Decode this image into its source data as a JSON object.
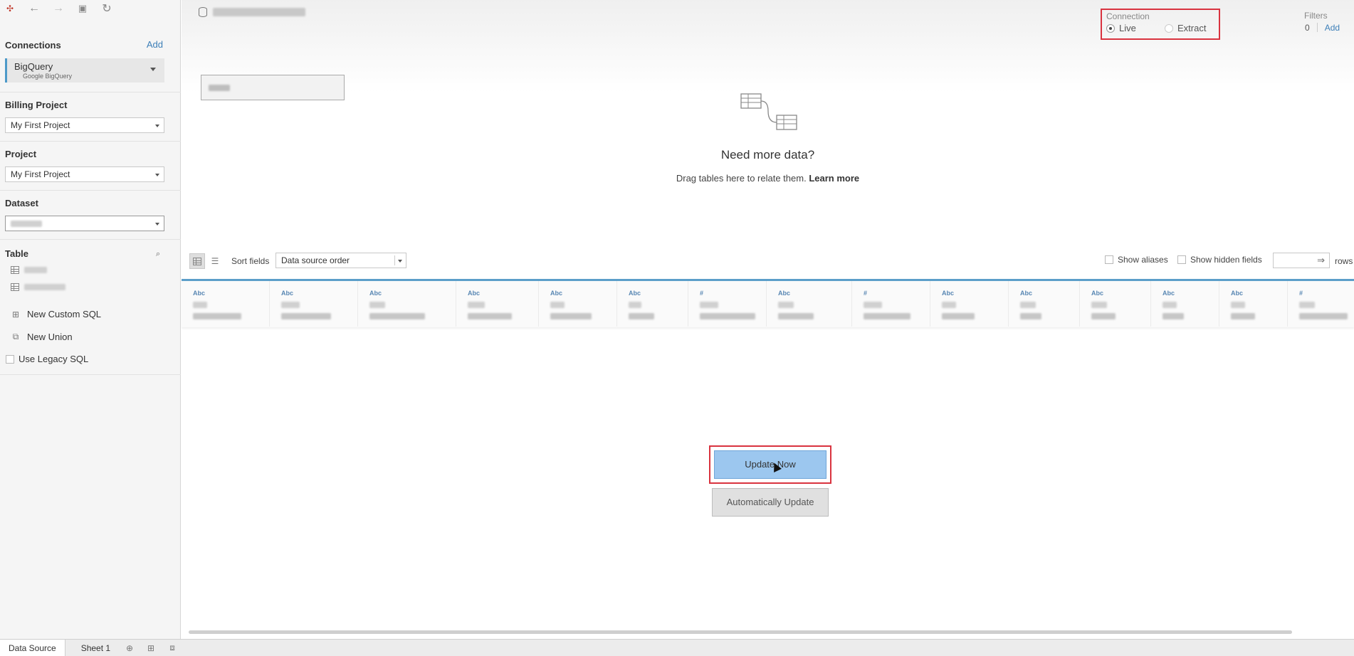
{
  "sidebar": {
    "connections": {
      "title": "Connections",
      "add_label": "Add",
      "connection_name": "BigQuery",
      "connection_type": "Google BigQuery"
    },
    "billing_project": {
      "title": "Billing Project",
      "value": "My First Project"
    },
    "project": {
      "title": "Project",
      "value": "My First Project"
    },
    "dataset": {
      "title": "Dataset"
    },
    "table": {
      "title": "Table",
      "items_count_note": "",
      "new_custom_sql": "New Custom SQL",
      "new_union": "New Union",
      "use_legacy_sql": "Use Legacy SQL"
    }
  },
  "connection": {
    "label": "Connection",
    "live_label": "Live",
    "extract_label": "Extract",
    "selected": "Live"
  },
  "filters": {
    "label": "Filters",
    "count": "0",
    "add_label": "Add"
  },
  "canvas": {
    "need_more_title": "Need more data?",
    "drag_text": "Drag tables here to relate them.",
    "learn_more": "Learn more"
  },
  "grid_toolbar": {
    "sort_label": "Sort fields",
    "sort_value": "Data source order",
    "show_aliases": "Show aliases",
    "show_hidden": "Show hidden fields",
    "rows_label": "rows"
  },
  "fields": [
    {
      "type": "Abc"
    },
    {
      "type": "Abc"
    },
    {
      "type": "Abc"
    },
    {
      "type": "Abc"
    },
    {
      "type": "Abc"
    },
    {
      "type": "Abc"
    },
    {
      "type": "#"
    },
    {
      "type": "Abc"
    },
    {
      "type": "#"
    },
    {
      "type": "Abc"
    },
    {
      "type": "Abc"
    },
    {
      "type": "Abc"
    },
    {
      "type": "Abc"
    },
    {
      "type": "Abc"
    },
    {
      "type": "#"
    }
  ],
  "update": {
    "update_now": "Update Now",
    "auto_update": "Automatically Update"
  },
  "bottom_tabs": {
    "data_source": "Data Source",
    "sheet1": "Sheet 1"
  },
  "colors": {
    "accent": "#3d7fb8",
    "highlight": "#d9333f",
    "update_button": "#9cc7ef",
    "field_bar": "#5b9ec9"
  }
}
